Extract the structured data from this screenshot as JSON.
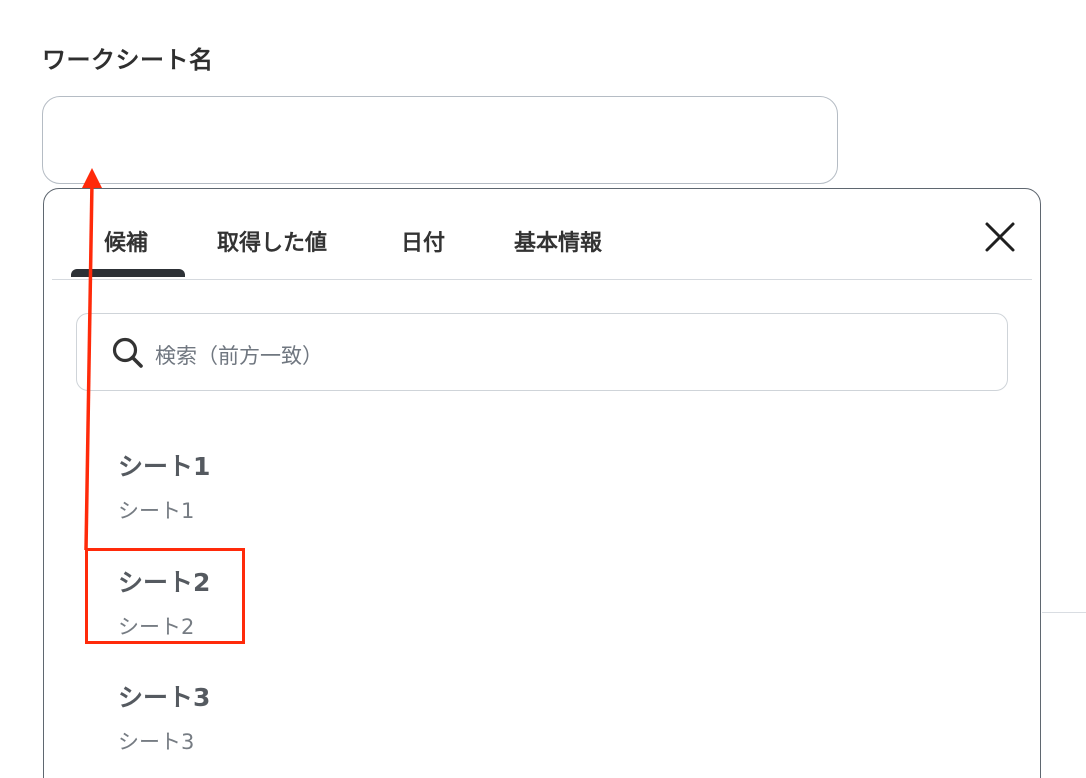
{
  "form": {
    "field_label": "ワークシート名",
    "input_value": ""
  },
  "dropdown": {
    "tabs": [
      {
        "label": "候補",
        "active": true
      },
      {
        "label": "取得した値",
        "active": false
      },
      {
        "label": "日付",
        "active": false
      },
      {
        "label": "基本情報",
        "active": false
      }
    ],
    "close_icon": "close-icon",
    "search": {
      "icon": "search-icon",
      "placeholder": "検索（前方一致）"
    },
    "options": [
      {
        "title": "シート1",
        "subtitle": "シート1"
      },
      {
        "title": "シート2",
        "subtitle": "シート2"
      },
      {
        "title": "シート3",
        "subtitle": "シート3"
      }
    ]
  },
  "annotation": {
    "highlighted_option": "シート2",
    "color": "#ff2a0a"
  },
  "colors": {
    "active_tab_indicator": "#2d3136",
    "panel_border": "#5f6770",
    "input_border": "#b5bcc4"
  }
}
